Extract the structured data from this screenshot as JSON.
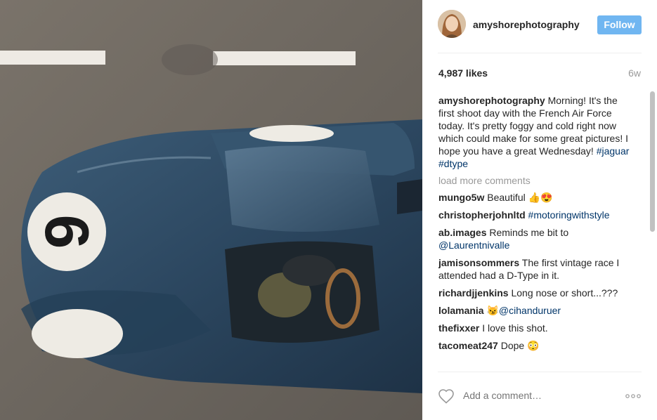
{
  "post": {
    "username": "amyshorephotography",
    "follow_label": "Follow",
    "likes": "4,987 likes",
    "age": "6w",
    "caption": {
      "user": "amyshorephotography",
      "text": " Morning! It's the first shoot day with the French Air Force today. It's pretty foggy and cold right now which could make for some great pictures! I hope you have a great Wednesday! ",
      "tags": [
        "#jaguar",
        "#dtype"
      ]
    },
    "load_more": "load more comments",
    "comments": [
      {
        "user": "mungo5w",
        "text": " Beautiful 👍😍"
      },
      {
        "user": "christopherjohnltd",
        "mention": " #motoringwithstyle"
      },
      {
        "user": "ab.images",
        "text": " Reminds me bit to ",
        "mention": "@Laurentnivalle"
      },
      {
        "user": "jamisonsommers",
        "text": " The first vintage race I attended had a D-Type in it."
      },
      {
        "user": "richardjjenkins",
        "text": " Long nose or short...???"
      },
      {
        "user": "lolamania",
        "text": " 😼",
        "mention": "@cihanduruer"
      },
      {
        "user": "thefixxer",
        "text": " I love this shot."
      },
      {
        "user": "tacomeat247",
        "text": " Dope 😳"
      }
    ],
    "add_comment_placeholder": "Add a comment…",
    "car_number": "6"
  },
  "colors": {
    "follow_bg": "#70b6f1",
    "link": "#003569",
    "car_body": "#2d4a63",
    "road": "#6e6860"
  },
  "icons": {
    "like": "heart-outline-icon",
    "options": "three-dots-icon"
  }
}
